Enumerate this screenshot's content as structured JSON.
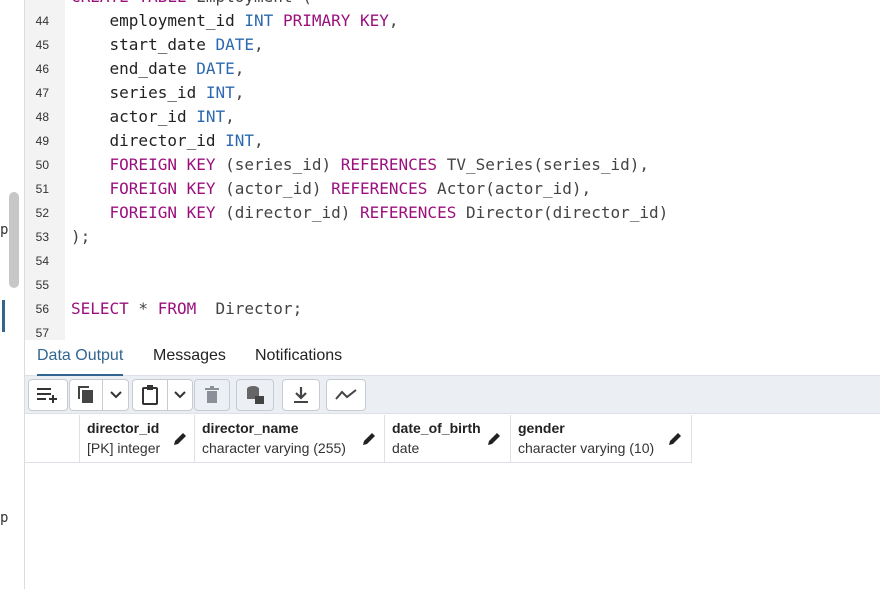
{
  "left_strip": {
    "glyphs": [
      "p",
      "p"
    ]
  },
  "editor": {
    "lines": [
      {
        "num": "44",
        "parts": [
          [
            "    employment_id ",
            ""
          ],
          [
            "INT",
            "ty"
          ],
          [
            " ",
            ""
          ],
          [
            "PRIMARY KEY",
            "kw"
          ],
          [
            ",",
            "punct"
          ]
        ]
      },
      {
        "num": "45",
        "parts": [
          [
            "    start_date ",
            ""
          ],
          [
            "DATE",
            "ty"
          ],
          [
            ",",
            "punct"
          ]
        ]
      },
      {
        "num": "46",
        "parts": [
          [
            "    end_date ",
            ""
          ],
          [
            "DATE",
            "ty"
          ],
          [
            ",",
            "punct"
          ]
        ]
      },
      {
        "num": "47",
        "parts": [
          [
            "    series_id ",
            ""
          ],
          [
            "INT",
            "ty"
          ],
          [
            ",",
            "punct"
          ]
        ]
      },
      {
        "num": "48",
        "parts": [
          [
            "    actor_id ",
            ""
          ],
          [
            "INT",
            "ty"
          ],
          [
            ",",
            "punct"
          ]
        ]
      },
      {
        "num": "49",
        "parts": [
          [
            "    director_id ",
            ""
          ],
          [
            "INT",
            "ty"
          ],
          [
            ",",
            "punct"
          ]
        ]
      },
      {
        "num": "50",
        "parts": [
          [
            "    ",
            ""
          ],
          [
            "FOREIGN KEY",
            "kw"
          ],
          [
            " (series_id) ",
            "punct"
          ],
          [
            "REFERENCES",
            "kw"
          ],
          [
            " TV_Series(series_id),",
            "punct"
          ]
        ]
      },
      {
        "num": "51",
        "parts": [
          [
            "    ",
            ""
          ],
          [
            "FOREIGN KEY",
            "kw"
          ],
          [
            " (actor_id) ",
            "punct"
          ],
          [
            "REFERENCES",
            "kw"
          ],
          [
            " Actor(actor_id),",
            "punct"
          ]
        ]
      },
      {
        "num": "52",
        "parts": [
          [
            "    ",
            ""
          ],
          [
            "FOREIGN KEY",
            "kw"
          ],
          [
            " (director_id) ",
            "punct"
          ],
          [
            "REFERENCES",
            "kw"
          ],
          [
            " Director(director_id)",
            "punct"
          ]
        ]
      },
      {
        "num": "53",
        "parts": [
          [
            ");",
            "punct"
          ]
        ]
      },
      {
        "num": "54",
        "parts": []
      },
      {
        "num": "55",
        "parts": []
      },
      {
        "num": "56",
        "parts": [
          [
            "SELECT",
            "kw"
          ],
          [
            " * ",
            "punct"
          ],
          [
            "FROM",
            "kw"
          ],
          [
            "  Director;",
            "punct"
          ]
        ]
      },
      {
        "num": "57",
        "parts": []
      }
    ],
    "partial_top_line": [
      [
        "CREATE TABLE",
        "kw"
      ],
      [
        " Employment (",
        "punct"
      ]
    ]
  },
  "tabs": [
    "Data Output",
    "Messages",
    "Notifications"
  ],
  "active_tab": "Data Output",
  "toolbar": {
    "buttons": [
      "add-row-icon",
      "copy-icon",
      "copy-options-chevron-icon",
      "paste-icon",
      "paste-options-chevron-icon",
      "delete-icon",
      "save-data-icon",
      "download-icon",
      "graph-icon"
    ]
  },
  "grid": {
    "columns": [
      {
        "name": "director_id",
        "type": "[PK] integer"
      },
      {
        "name": "director_name",
        "type": "character varying (255)"
      },
      {
        "name": "date_of_birth",
        "type": "date"
      },
      {
        "name": "gender",
        "type": "character varying (10)"
      }
    ]
  }
}
